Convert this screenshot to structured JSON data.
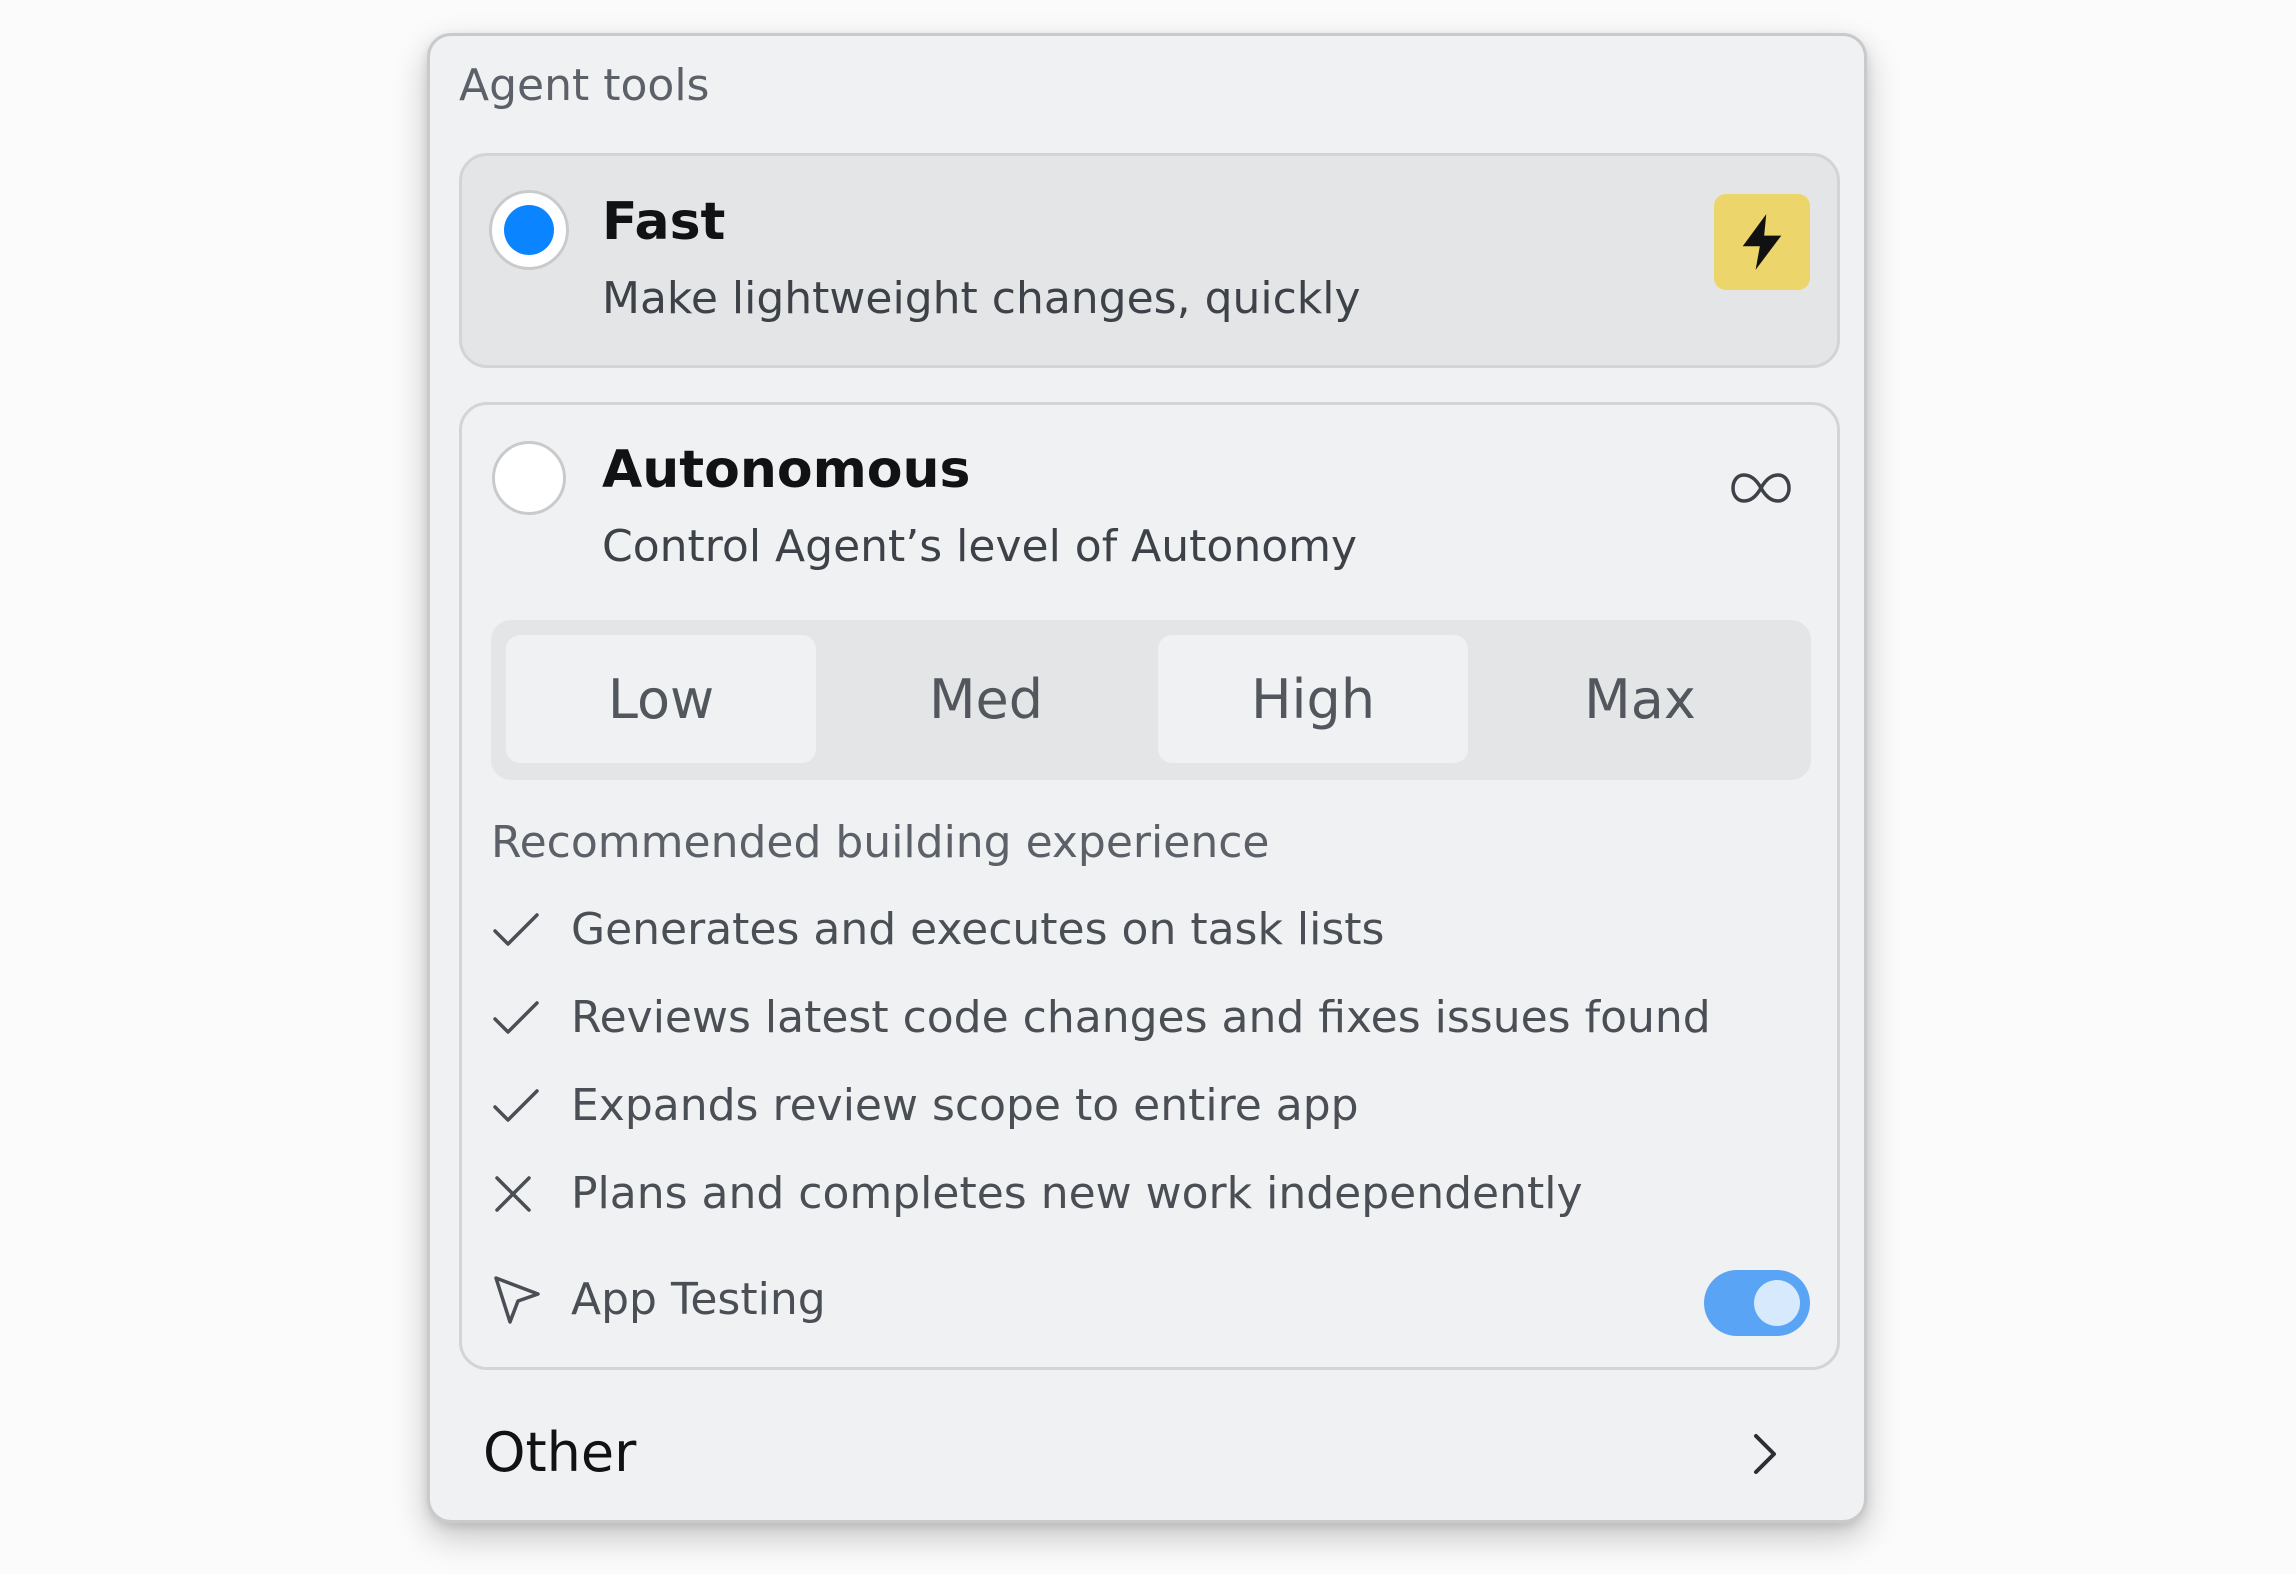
{
  "panel": {
    "title": "Agent tools"
  },
  "options": {
    "fast": {
      "title": "Fast",
      "description": "Make lightweight changes, quickly",
      "selected": true,
      "icon": "lightning-bolt-icon",
      "badge_color": "#ECD56A"
    },
    "autonomous": {
      "title": "Autonomous",
      "description": "Control Agent’s level of Autonomy",
      "selected": false,
      "icon": "infinity-icon"
    }
  },
  "autonomy_levels": {
    "items": [
      "Low",
      "Med",
      "High",
      "Max"
    ]
  },
  "experience": {
    "heading": "Recommended building experience",
    "features": [
      {
        "text": "Generates and executes on task lists",
        "included": true,
        "icon": "check-icon"
      },
      {
        "text": "Reviews latest code changes and fixes issues found",
        "included": true,
        "icon": "check-icon"
      },
      {
        "text": "Expands review scope to entire app",
        "included": true,
        "icon": "check-icon"
      },
      {
        "text": "Plans and completes new work independently",
        "included": false,
        "icon": "x-icon"
      }
    ],
    "app_testing": {
      "label": "App Testing",
      "icon": "cursor-pointer-icon",
      "enabled": true
    }
  },
  "other": {
    "label": "Other",
    "icon": "chevron-right-icon"
  },
  "colors": {
    "accent": "#0A84FF",
    "toggle_on": "#5AA4F5",
    "panel_bg": "#F0F1F2"
  }
}
